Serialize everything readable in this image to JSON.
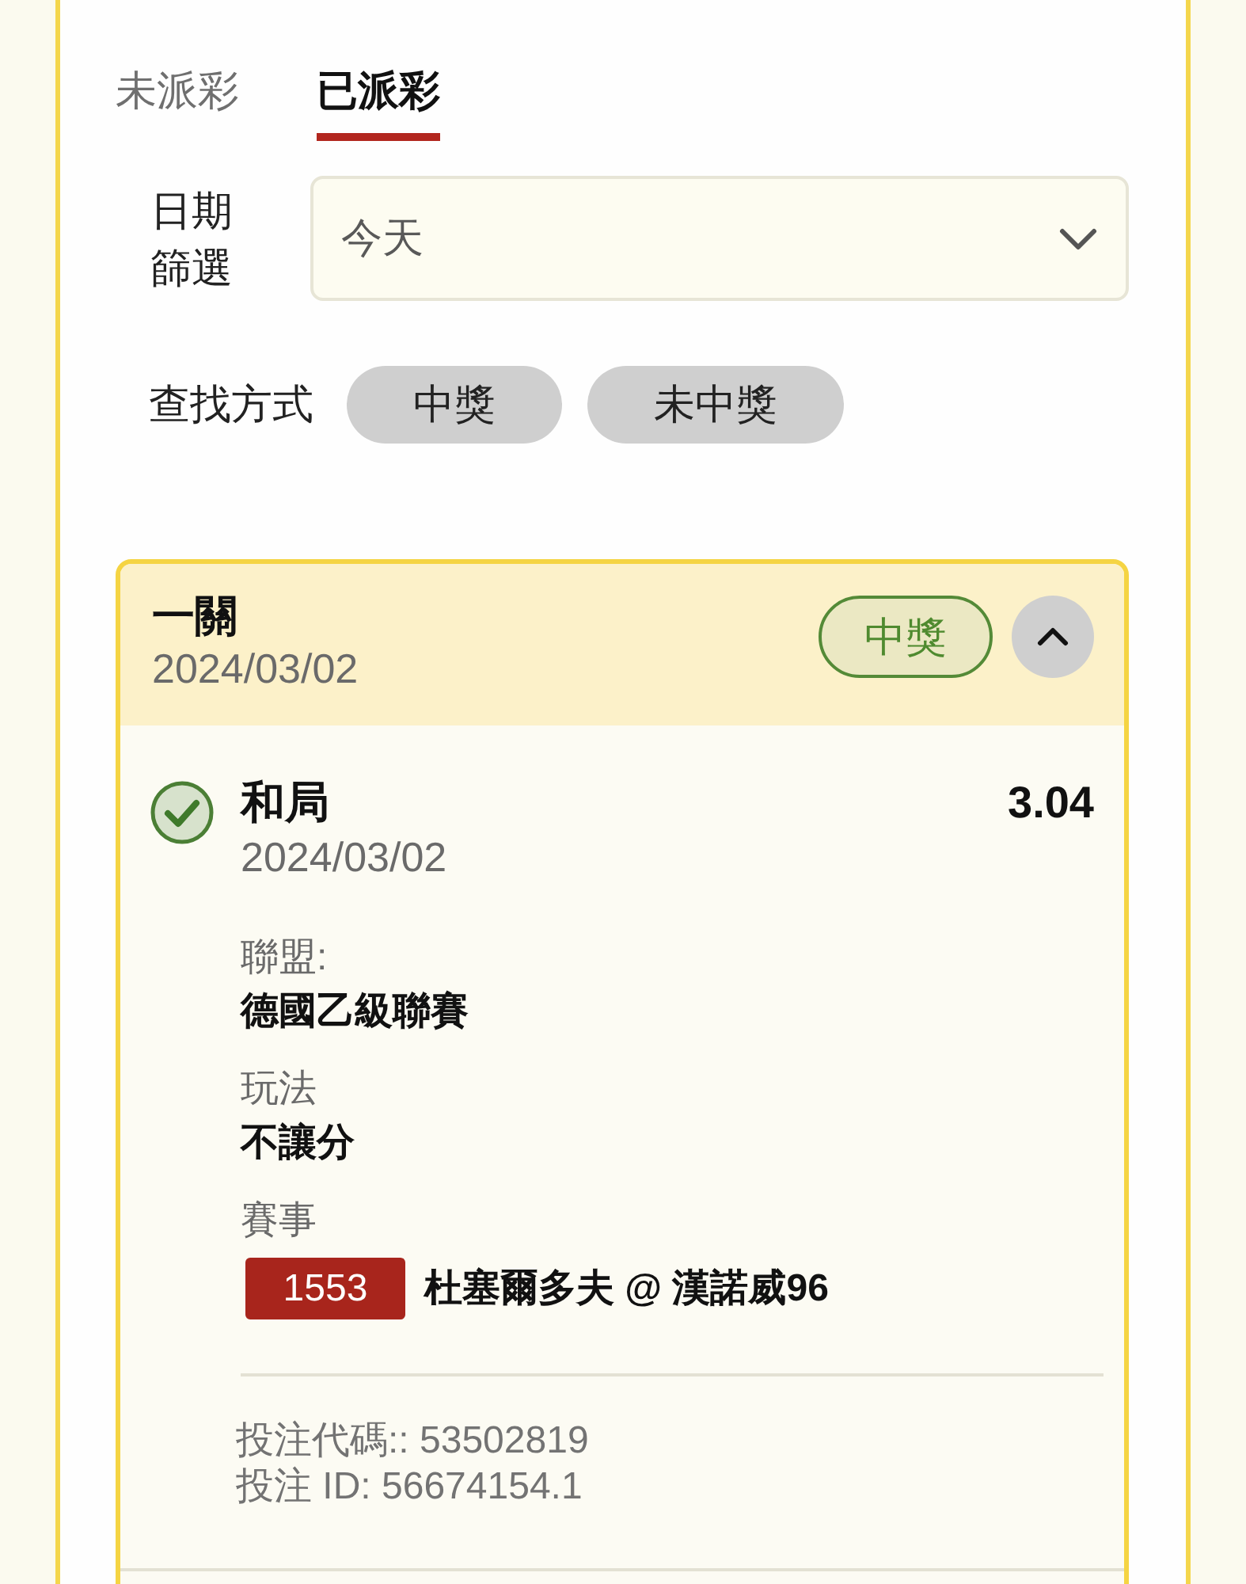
{
  "tabs": [
    {
      "label": "未派彩",
      "selected": false
    },
    {
      "label": "已派彩",
      "selected": true
    }
  ],
  "date_filter": {
    "label": "日期篩選",
    "value": "今天"
  },
  "search_by": {
    "label": "查找方式",
    "options": [
      {
        "label": "中獎",
        "selected": false
      },
      {
        "label": "未中獎",
        "selected": false
      }
    ]
  },
  "bets": [
    {
      "title": "一關",
      "date": "2024/03/02",
      "status": {
        "label": "中獎",
        "kind": "won"
      },
      "expanded": true,
      "selections": [
        {
          "won": true,
          "outcome": "和局",
          "date": "2024/03/02",
          "odds": "3.04",
          "details": [
            {
              "kind": "text",
              "label": "聯盟:",
              "value": "德國乙級聯賽"
            },
            {
              "kind": "text",
              "label": "玩法",
              "value": "不讓分"
            },
            {
              "kind": "match",
              "label": "賽事",
              "match_no": "1553",
              "value": "杜塞爾多夫 @ 漢諾威96"
            }
          ]
        }
      ],
      "bet_code": "投注代碼:: 53502819",
      "bet_id": "投注 ID: 56674154.1"
    }
  ]
}
